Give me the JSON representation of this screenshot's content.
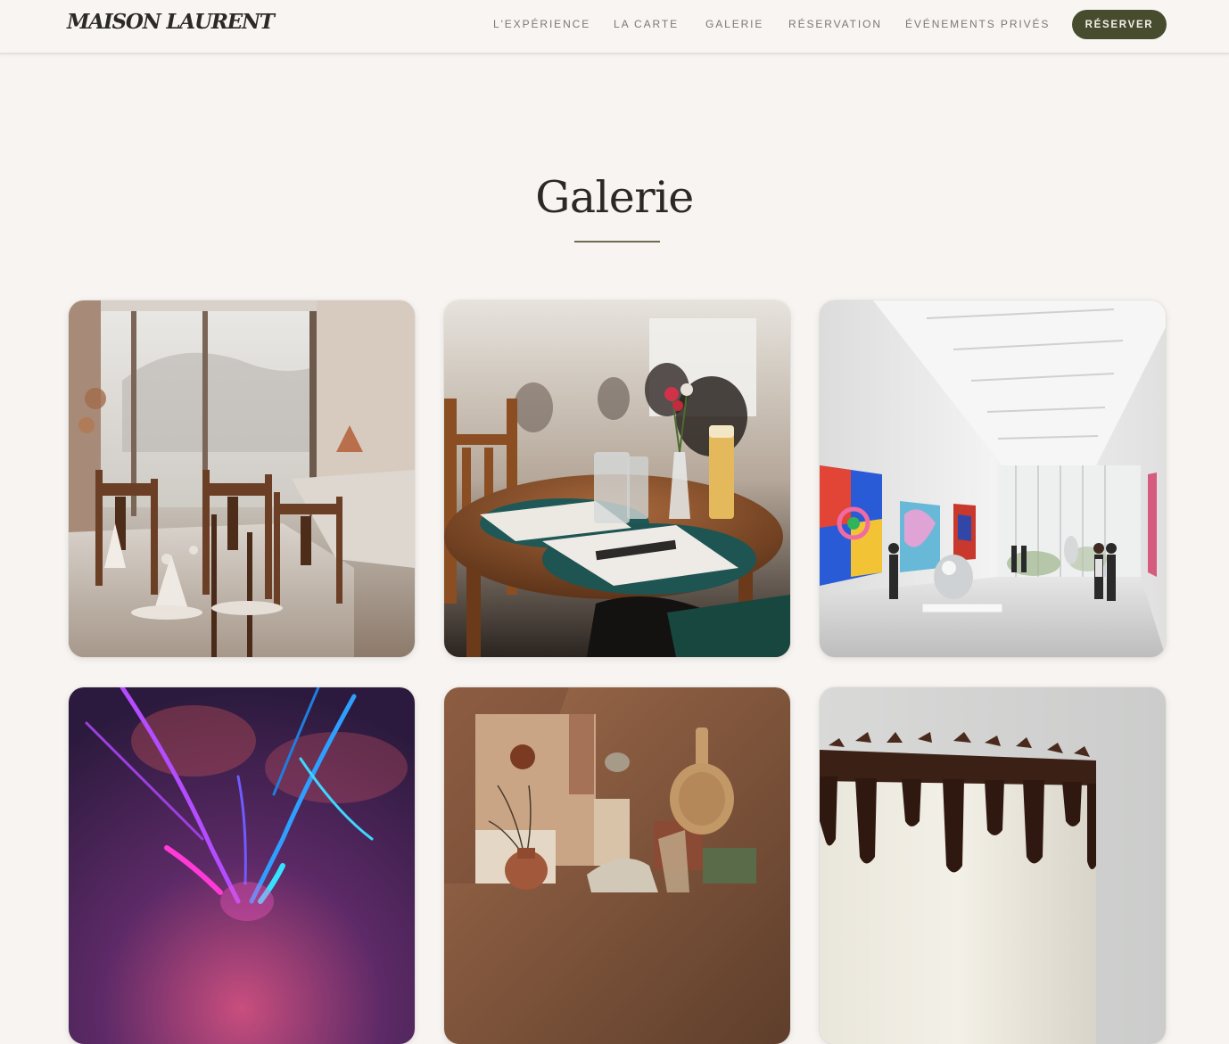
{
  "header": {
    "logo": "MAISON LAURENT",
    "nav": [
      {
        "label": "L'EXPÉRIENCE"
      },
      {
        "label": "LA CARTE"
      },
      {
        "label": "GALERIE"
      },
      {
        "label": "RÉSERVATION"
      },
      {
        "label": "ÉVÉNEMENTS PRIVÉS"
      }
    ],
    "cta_label": "RÉSERVER",
    "accent_color": "#484c2f"
  },
  "gallery": {
    "title": "Galerie",
    "images": [
      {
        "subject": "restaurant-dining-room-photo"
      },
      {
        "subject": "cafe-table-flowers-photo"
      },
      {
        "subject": "art-gallery-interior-photo"
      },
      {
        "subject": "abstract-purple-blue-art-photo"
      },
      {
        "subject": "earth-tone-still-life-photo"
      },
      {
        "subject": "chocolate-drip-cake-photo"
      }
    ]
  }
}
